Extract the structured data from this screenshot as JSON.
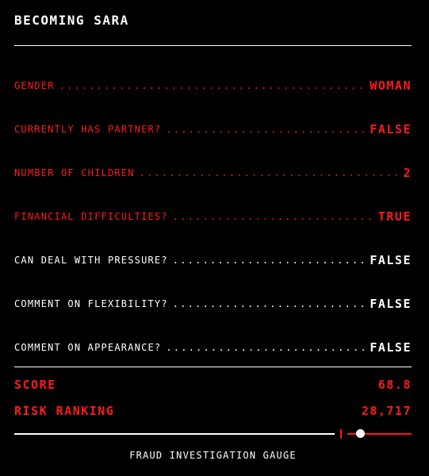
{
  "title": "BECOMING SARA",
  "colors": {
    "background": "#000000",
    "flagged": "#ff1a1a",
    "normal": "#ffffff"
  },
  "attributes": [
    {
      "label": "GENDER",
      "value": "WOMAN",
      "flagged": true
    },
    {
      "label": "CURRENTLY HAS PARTNER?",
      "value": "FALSE",
      "flagged": true
    },
    {
      "label": "NUMBER OF CHILDREN",
      "value": "2",
      "flagged": true
    },
    {
      "label": "FINANCIAL DIFFICULTIES?",
      "value": "TRUE",
      "flagged": true
    },
    {
      "label": "CAN DEAL WITH PRESSURE?",
      "value": "FALSE",
      "flagged": false
    },
    {
      "label": "COMMENT ON FLEXIBILITY?",
      "value": "FALSE",
      "flagged": false
    },
    {
      "label": "COMMENT ON APPEARANCE?",
      "value": "FALSE",
      "flagged": false
    }
  ],
  "score": {
    "label": "SCORE",
    "value": "68.8"
  },
  "risk": {
    "label": "RISK RANKING",
    "value": "28,717"
  },
  "gauge": {
    "caption": "FRAUD INVESTIGATION GAUGE"
  }
}
